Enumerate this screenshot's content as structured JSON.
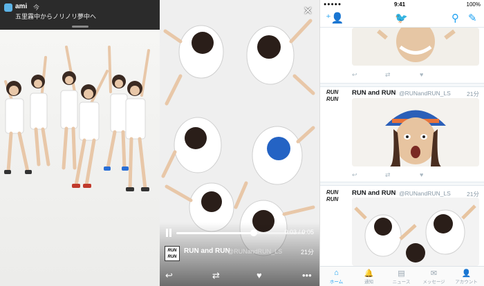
{
  "left_panel": {
    "notification": {
      "app_name": "ami",
      "time": "今",
      "message": "五里霧中からノリノリ夢中へ"
    }
  },
  "middle_panel": {
    "close_glyph": "✕",
    "video": {
      "time": "0:03 / 0:05",
      "progress": 0.6
    },
    "tweet": {
      "avatar_text": "RUN\nRUN",
      "name": "RUN and RUN",
      "handle": "@RUNandRUN_LS",
      "ago": "21分"
    }
  },
  "right_panel": {
    "status_bar": {
      "signal": "●●●●●",
      "time": "9:41",
      "battery": "100%"
    },
    "feed": [
      {
        "avatar_text": "RUN\nRUN",
        "name": "RUN and RUN",
        "handle": "@RUNandRUN_LS",
        "ago": "21分"
      },
      {
        "avatar_text": "RUN\nRUN",
        "name": "RUN and RUN",
        "handle": "@RUNandRUN_LS",
        "ago": "21分"
      }
    ],
    "tabs": [
      {
        "label": "ホーム",
        "icon": "home-icon",
        "active": true
      },
      {
        "label": "通知",
        "icon": "bell-icon",
        "active": false
      },
      {
        "label": "ニュース",
        "icon": "news-icon",
        "active": false
      },
      {
        "label": "メッセージ",
        "icon": "envelope-icon",
        "active": false
      },
      {
        "label": "アカウント",
        "icon": "person-icon",
        "active": false
      }
    ]
  },
  "colors": {
    "twitter_blue": "#1da1f2",
    "notification_bg": "#2b2b2b"
  }
}
